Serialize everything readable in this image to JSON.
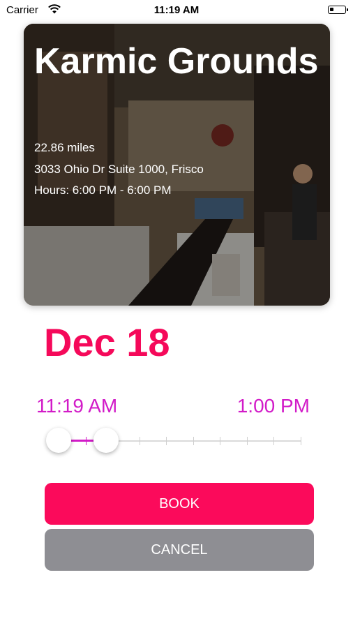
{
  "status_bar": {
    "carrier": "Carrier",
    "time": "11:19 AM",
    "wifi_icon": "wifi-icon",
    "battery_icon": "battery-icon"
  },
  "shop": {
    "name": "Karmic Grounds",
    "distance": "22.86 miles",
    "address": "3033 Ohio Dr Suite 1000, Frisco",
    "hours": "Hours: 6:00 PM - 6:00 PM",
    "photo": "coffee-shop-interior-photo"
  },
  "booking": {
    "date": "Dec 18",
    "start_time": "11:19 AM",
    "end_time": "1:00 PM"
  },
  "slider": {
    "tick_count": 10,
    "selected_from_tick": 0,
    "selected_to_tick": 2
  },
  "buttons": {
    "book": "BOOK",
    "cancel": "CANCEL"
  },
  "colors": {
    "accent_pink": "#f5095a",
    "accent_magenta": "#d21bc8",
    "book_button": "#fb0a5b",
    "cancel_button": "#8e8e93"
  }
}
